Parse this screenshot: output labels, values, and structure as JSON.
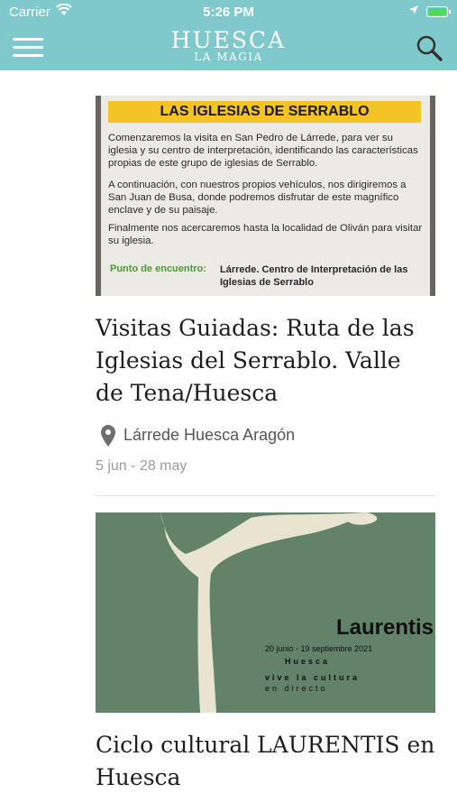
{
  "status": {
    "carrier": "Carrier",
    "time": "5:26 PM"
  },
  "header": {
    "logo_main": "HUESCA",
    "logo_sub": "LA MAGIA",
    "menu_icon": "hamburger-menu-icon",
    "search_icon": "search-icon"
  },
  "theme": {
    "accent": "#7fc9cd",
    "img1_band": "#f4c326",
    "img2_bg": "#62826a"
  },
  "cards": [
    {
      "image": {
        "band": "LAS IGLESIAS DE SERRABLO",
        "p1": "Comenzaremos la visita en San Pedro de Lárrede, para ver su iglesia y su centro de interpretación, identificando las características propias de este grupo de iglesias de Serrablo.",
        "p2": "A continuación, con nuestros propios vehículos, nos dirigiremos a San Juan de Busa, donde podremos disfrutar de este magnífico enclave y de su paisaje.",
        "p3": "Finalmente nos acercaremos hasta la localidad de Oliván para visitar su iglesia.",
        "meet_label": "Punto de encuentro:",
        "meet_value": "Lárrede. Centro de Interpretación de las Iglesias de Serrablo"
      },
      "title": "Visitas Guiadas: Ruta de las Iglesias del Serrablo. Valle de Tena/Huesca",
      "location": "Lárrede Huesca Aragón",
      "dates": "5 jun - 28 may"
    },
    {
      "image": {
        "title": "Laurentis",
        "date": "20 junio - 19 septiembre 2021",
        "city": "Huesca",
        "tagline1": "vive la cultura",
        "tagline2": "en directo"
      },
      "title": "Ciclo cultural LAURENTIS en Huesca"
    }
  ]
}
